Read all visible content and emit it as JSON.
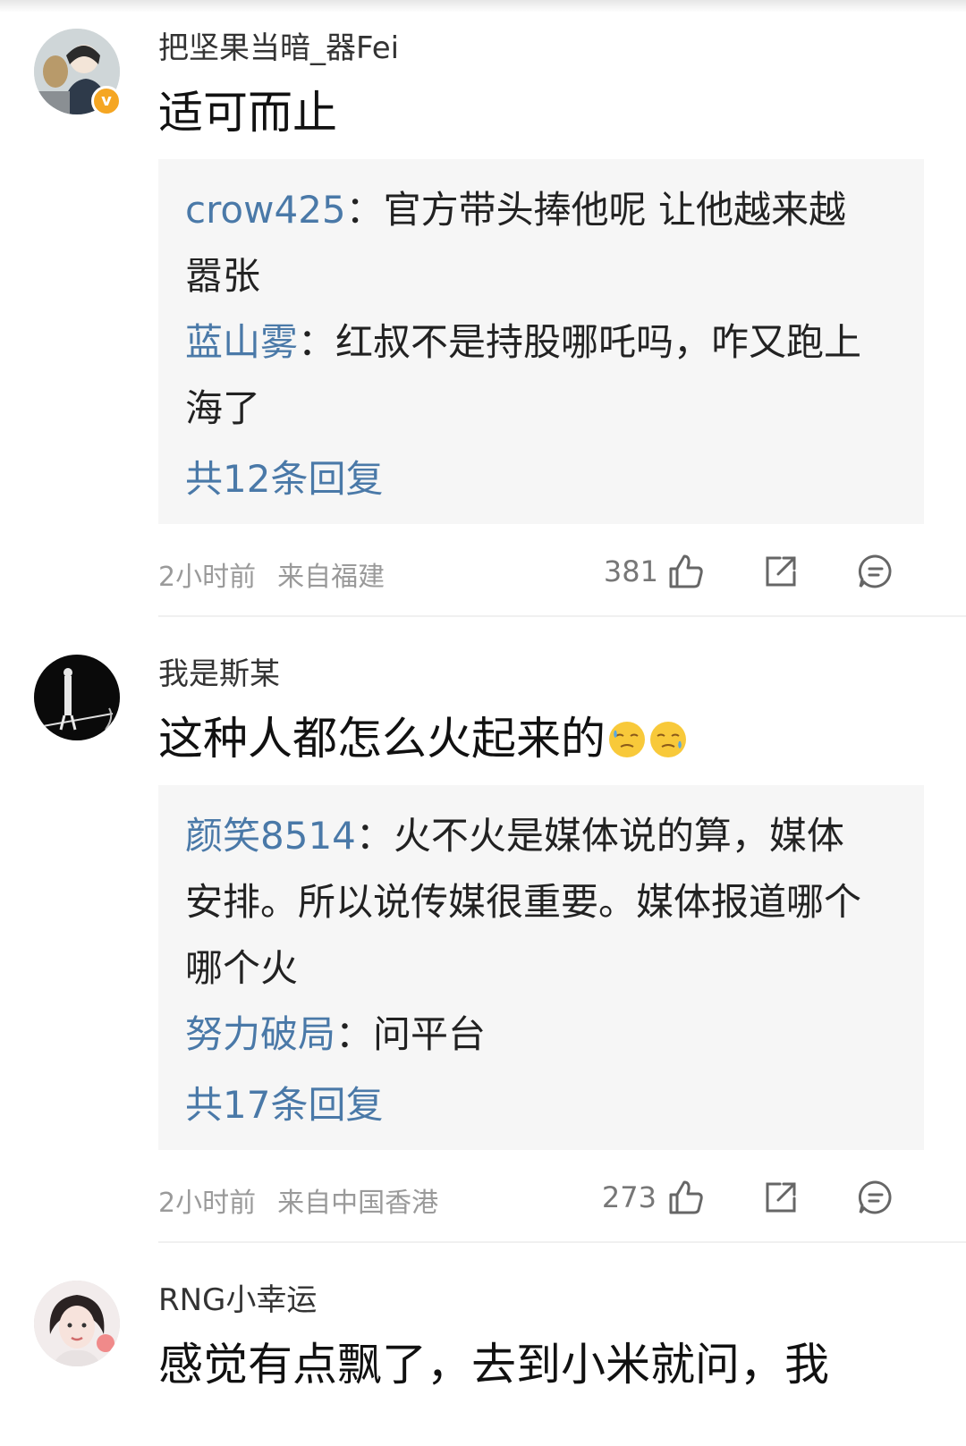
{
  "comments": [
    {
      "username": "把坚果当暗_器Fei",
      "text": "适可而止",
      "replies": [
        {
          "name": "crow425",
          "sep": "：",
          "text": "官方带头捧他呢 让他越来越嚣张"
        },
        {
          "name": "蓝山雾",
          "sep": "：",
          "text": "红叔不是持股哪吒吗，咋又跑上海了"
        }
      ],
      "reply_count": "共12条回复",
      "time": "2小时前",
      "location": "来自福建",
      "likes": "381"
    },
    {
      "username": "我是斯某",
      "text": "这种人都怎么火起来的",
      "replies": [
        {
          "name": "颜笑8514",
          "sep": "：",
          "text": "火不火是媒体说的算，媒体安排。所以说传媒很重要。媒体报道哪个哪个火"
        },
        {
          "name": "努力破局",
          "sep": "：",
          "text": "问平台"
        }
      ],
      "reply_count": "共17条回复",
      "time": "2小时前",
      "location": "来自中国香港",
      "likes": "273"
    },
    {
      "username": "RNG小幸运",
      "text": "感觉有点飘了，去到小米就问，我"
    }
  ],
  "colors": {
    "link": "#4a79a8",
    "meta": "#9a9a9a",
    "badge": "#f5a623"
  },
  "icons": [
    "thumbs-up-icon",
    "share-icon",
    "comment-icon",
    "verified-badge-icon",
    "sweat-emoji-icon"
  ]
}
